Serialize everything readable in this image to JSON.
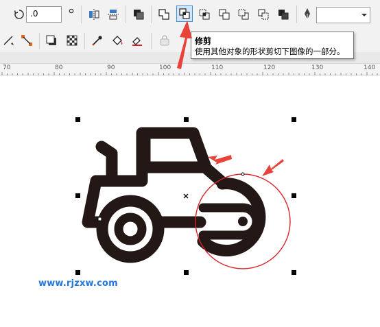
{
  "toolbar": {
    "rotation_value": ".0",
    "outline_value": "",
    "buttons": {
      "trim_selected": true
    }
  },
  "tooltip": {
    "title": "修剪",
    "description": "使用其他对象的形状剪切下图像的一部分。"
  },
  "ruler": {
    "labels": [
      "70",
      "80",
      "90",
      "100",
      "110",
      "120",
      "130",
      "140"
    ]
  },
  "watermark": {
    "text": "www.rjzxw.com"
  },
  "colors": {
    "accent_selection": "#3c8fd6",
    "arrow_red": "#e8423a",
    "drawing_stroke": "#231815",
    "circle_outline": "#d9252a",
    "watermark": "#2176e0"
  },
  "icons": [
    "rotate-icon",
    "mirror-horizontal-icon",
    "mirror-vertical-icon",
    "group-icon",
    "weld-icon",
    "trim-icon",
    "intersect-icon",
    "simplify-icon",
    "front-minus-back-icon",
    "back-minus-front-icon",
    "boundary-icon",
    "pen-nib-icon",
    "line-tool-icon",
    "connector-tool-icon",
    "drop-shadow-icon",
    "transparency-icon",
    "eyedropper-icon",
    "fill-icon",
    "interactive-fill-icon",
    "lock-icon"
  ]
}
